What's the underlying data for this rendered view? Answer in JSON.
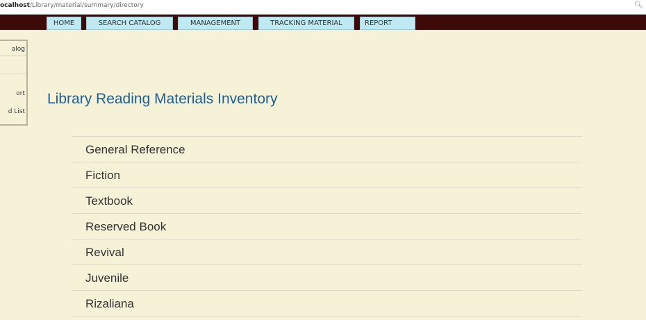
{
  "browser": {
    "url_host": "ocalhost",
    "url_path": "/Library/material/summary/directory",
    "zoom_icon": "zoom-icon"
  },
  "nav": {
    "items": [
      "HOME",
      "SEARCH CATALOG",
      "MANAGEMENT",
      "TRACKING MATERIAL",
      "REPORT",
      ""
    ]
  },
  "sidebar": {
    "items": [
      "alog",
      "",
      "ort",
      "d List"
    ]
  },
  "main": {
    "title": "Library Reading Materials Inventory",
    "categories": [
      "General Reference",
      "Fiction",
      "Textbook",
      "Reserved Book",
      "Revival",
      "Juvenile",
      "Rizaliana"
    ]
  },
  "colors": {
    "background": "#f5f2d8",
    "navbar": "#3d0a0a",
    "nav_button": "#bfeaf3",
    "title": "#1f5f8f"
  }
}
